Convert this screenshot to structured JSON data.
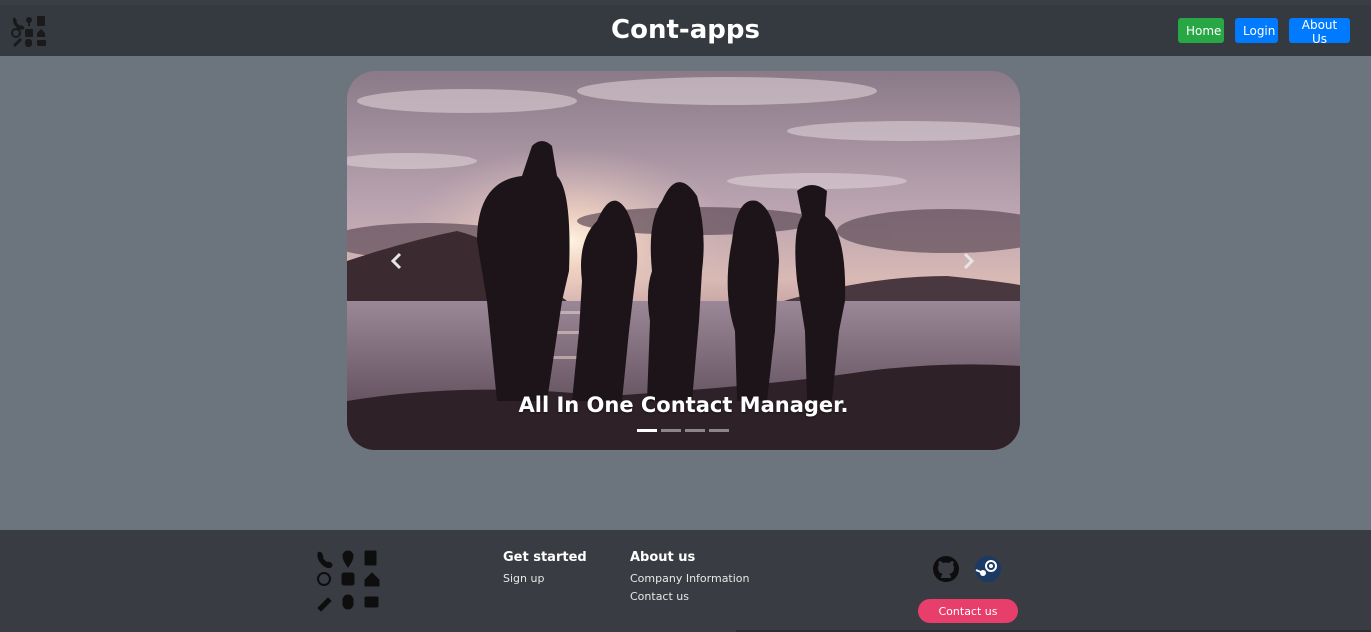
{
  "header": {
    "logo_icon": "contacts-grid-icon",
    "brand": "Cont-apps",
    "nav": {
      "home_label": "Home",
      "login_label": "Login",
      "about_label": "About Us"
    }
  },
  "carousel": {
    "caption": "All In One Contact Manager.",
    "prev_icon": "chevron-left-icon",
    "next_icon": "chevron-right-icon",
    "slide_count": 4,
    "active_slide": 1
  },
  "footer": {
    "icons": [
      "phone-icon",
      "location-pin-icon",
      "note-icon",
      "target-icon",
      "inbox-icon",
      "home-icon",
      "link-icon",
      "mouse-icon",
      "id-card-icon"
    ],
    "get_started": {
      "heading": "Get started",
      "links": [
        "Sign up"
      ]
    },
    "about": {
      "heading": "About us",
      "links": [
        "Company Information",
        "Contact us"
      ]
    },
    "social_icons": [
      "github-icon",
      "steam-icon"
    ],
    "contact_button": "Contact us"
  },
  "colors": {
    "navbar": "#343a40",
    "page_bg": "#6c757d",
    "footer": "#393c42",
    "home_btn": "#28a745",
    "primary_btn": "#007bff",
    "contact_btn": "#e83e6c"
  }
}
